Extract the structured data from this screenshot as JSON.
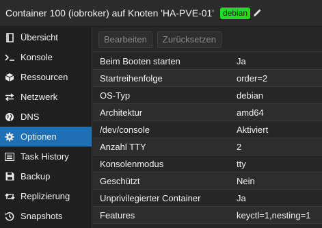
{
  "header": {
    "title": "Container 100 (iobroker) auf Knoten 'HA-PVE-01'",
    "tag": "debian",
    "colors": {
      "tag_bg": "#22dd22",
      "active_nav": "#1f6fb5"
    }
  },
  "sidebar": {
    "items": [
      {
        "label": "Übersicht",
        "icon": "book-icon"
      },
      {
        "label": "Konsole",
        "icon": "terminal-icon"
      },
      {
        "label": "Ressourcen",
        "icon": "cube-icon"
      },
      {
        "label": "Netzwerk",
        "icon": "exchange-arrows-icon"
      },
      {
        "label": "DNS",
        "icon": "globe-icon"
      },
      {
        "label": "Optionen",
        "icon": "gear-icon",
        "active": true
      },
      {
        "label": "Task History",
        "icon": "list-icon"
      },
      {
        "label": "Backup",
        "icon": "floppy-disk-icon"
      },
      {
        "label": "Replizierung",
        "icon": "retweet-icon"
      },
      {
        "label": "Snapshots",
        "icon": "history-icon"
      }
    ]
  },
  "toolbar": {
    "edit_label": "Bearbeiten",
    "revert_label": "Zurücksetzen"
  },
  "options": {
    "rows": [
      {
        "key": "Beim Booten starten",
        "value": "Ja"
      },
      {
        "key": "Startreihenfolge",
        "value": "order=2"
      },
      {
        "key": "OS-Typ",
        "value": "debian"
      },
      {
        "key": "Architektur",
        "value": "amd64"
      },
      {
        "key": "/dev/console",
        "value": "Aktiviert"
      },
      {
        "key": "Anzahl TTY",
        "value": "2"
      },
      {
        "key": "Konsolenmodus",
        "value": "tty"
      },
      {
        "key": "Geschützt",
        "value": "Nein"
      },
      {
        "key": "Unprivilegierter Container",
        "value": "Ja"
      },
      {
        "key": "Features",
        "value": "keyctl=1,nesting=1"
      }
    ]
  }
}
